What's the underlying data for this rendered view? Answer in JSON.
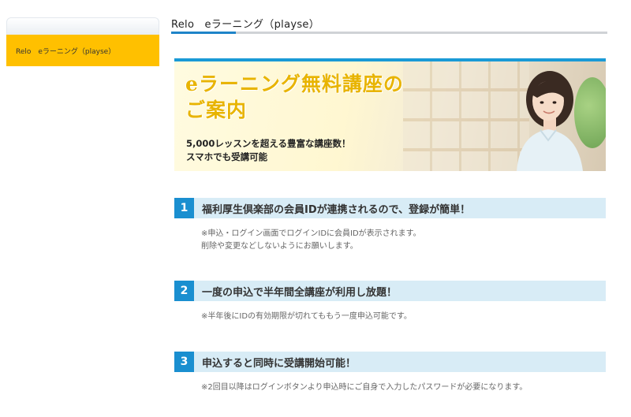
{
  "header": {
    "title": "Relo　eラーニング（playse）"
  },
  "sidebar": {
    "items": [
      {
        "label": "Relo　eラーニング（playse）"
      }
    ]
  },
  "banner": {
    "headline_line1": "eラーニング無料講座の",
    "headline_line2": "ご案内",
    "sub_line1": "5,000レッスンを超える豊富な講座数！",
    "sub_line2": "スマホでも受講可能"
  },
  "features": [
    {
      "number": "1",
      "title": "福利厚生倶楽部の会員IDが連携されるので、登録が簡単！",
      "notes": [
        "※申込・ログイン画面でログインIDに会員IDが表示されます。",
        "削除や変更などしないようにお願いします。"
      ]
    },
    {
      "number": "2",
      "title": "一度の申込で半年間全講座が利用し放題！",
      "notes": [
        "※半年後にIDの有効期限が切れてももう一度申込可能です。"
      ]
    },
    {
      "number": "3",
      "title": "申込すると同時に受講開始可能！",
      "notes": [
        "※2回目以降はログインボタンより申込時にご自身で入力したパスワードが必要になります。"
      ]
    }
  ],
  "colors": {
    "accent_blue": "#1a8fd0",
    "sidebar_active": "#ffc000",
    "feature_bg": "#d8ecf6",
    "headline_gold": "#e8b400"
  }
}
